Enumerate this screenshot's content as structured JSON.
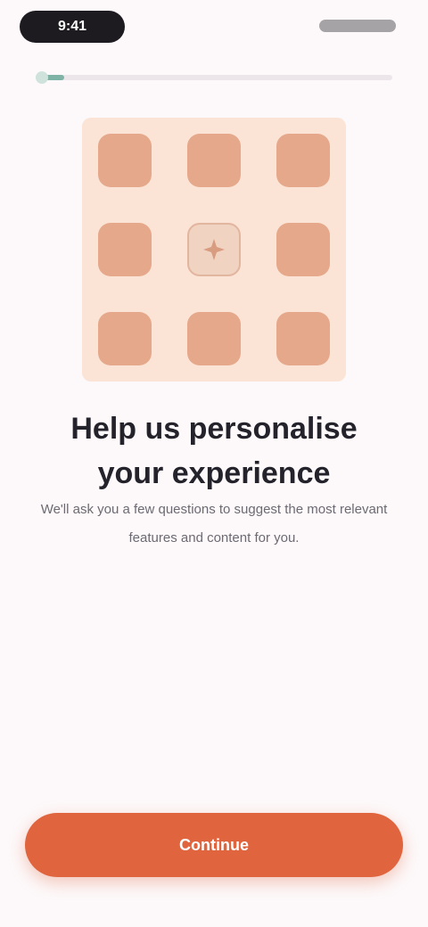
{
  "status_bar": {
    "time": "9:41"
  },
  "progress": {
    "fraction": 0.08
  },
  "illustration": {
    "grid": {
      "rows": 3,
      "cols": 3
    },
    "tile_color": "#e5a88b",
    "background_color": "#fbe3d5",
    "center_tile_icon": "sparkle-icon"
  },
  "onboarding": {
    "headline": "Help us personalise your experience",
    "subtext": "We'll ask you a few questions to suggest the most relevant features and content for you."
  },
  "cta": {
    "label": "Continue",
    "color": "#e0653f"
  }
}
